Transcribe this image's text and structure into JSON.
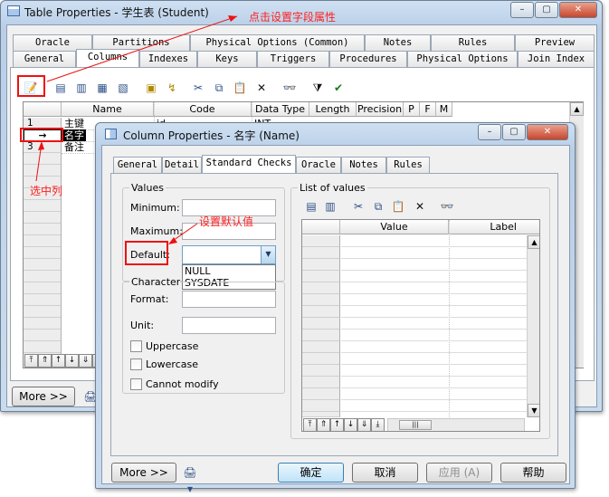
{
  "main_window": {
    "title": "Table Properties - 学生表 (Student)",
    "tabs_row1": [
      "Oracle",
      "Partitions",
      "Physical Options (Common)",
      "Notes",
      "Rules",
      "Preview"
    ],
    "tabs_row2": [
      "General",
      "Columns",
      "Indexes",
      "Keys",
      "Triggers",
      "Procedures",
      "Physical Options",
      "Join Index"
    ],
    "columns_header": [
      "Name",
      "Code",
      "Data Type",
      "Length",
      "Precision",
      "P",
      "F",
      "M"
    ],
    "rows": [
      {
        "num": "1",
        "name": "主键",
        "code": "id",
        "type": "INT"
      },
      {
        "num": "→",
        "name": "名字",
        "code": "",
        "type": ""
      },
      {
        "num": "3",
        "name": "备注",
        "code": "",
        "type": ""
      }
    ],
    "more_label": "More >>"
  },
  "dialog": {
    "title": "Column Properties - 名字 (Name)",
    "tabs": [
      "General",
      "Detail",
      "Standard Checks",
      "Oracle",
      "Notes",
      "Rules"
    ],
    "values_group": "Values",
    "minimum_label": "Minimum:",
    "maximum_label": "Maximum:",
    "default_label": "Default:",
    "default_options": [
      "NULL",
      "SYSDATE"
    ],
    "characteristics_group": "Characteristics",
    "format_label": "Format:",
    "unit_label": "Unit:",
    "uppercase_label": "Uppercase",
    "lowercase_label": "Lowercase",
    "cannot_modify_label": "Cannot modify",
    "list_of_values_label": "List of values",
    "lov_columns": [
      "Value",
      "Label"
    ],
    "more_label": "More >>",
    "ok_label": "确定",
    "cancel_label": "取消",
    "apply_label": "应用 (A)",
    "help_label": "帮助"
  },
  "annotations": {
    "set_field_properties": "点击设置字段属性",
    "select_column": "选中列",
    "set_default": "设置默认值"
  },
  "colors": {
    "annotation": "#ff1f1f",
    "selection": "#000000",
    "accent": "#3c7fb1"
  }
}
